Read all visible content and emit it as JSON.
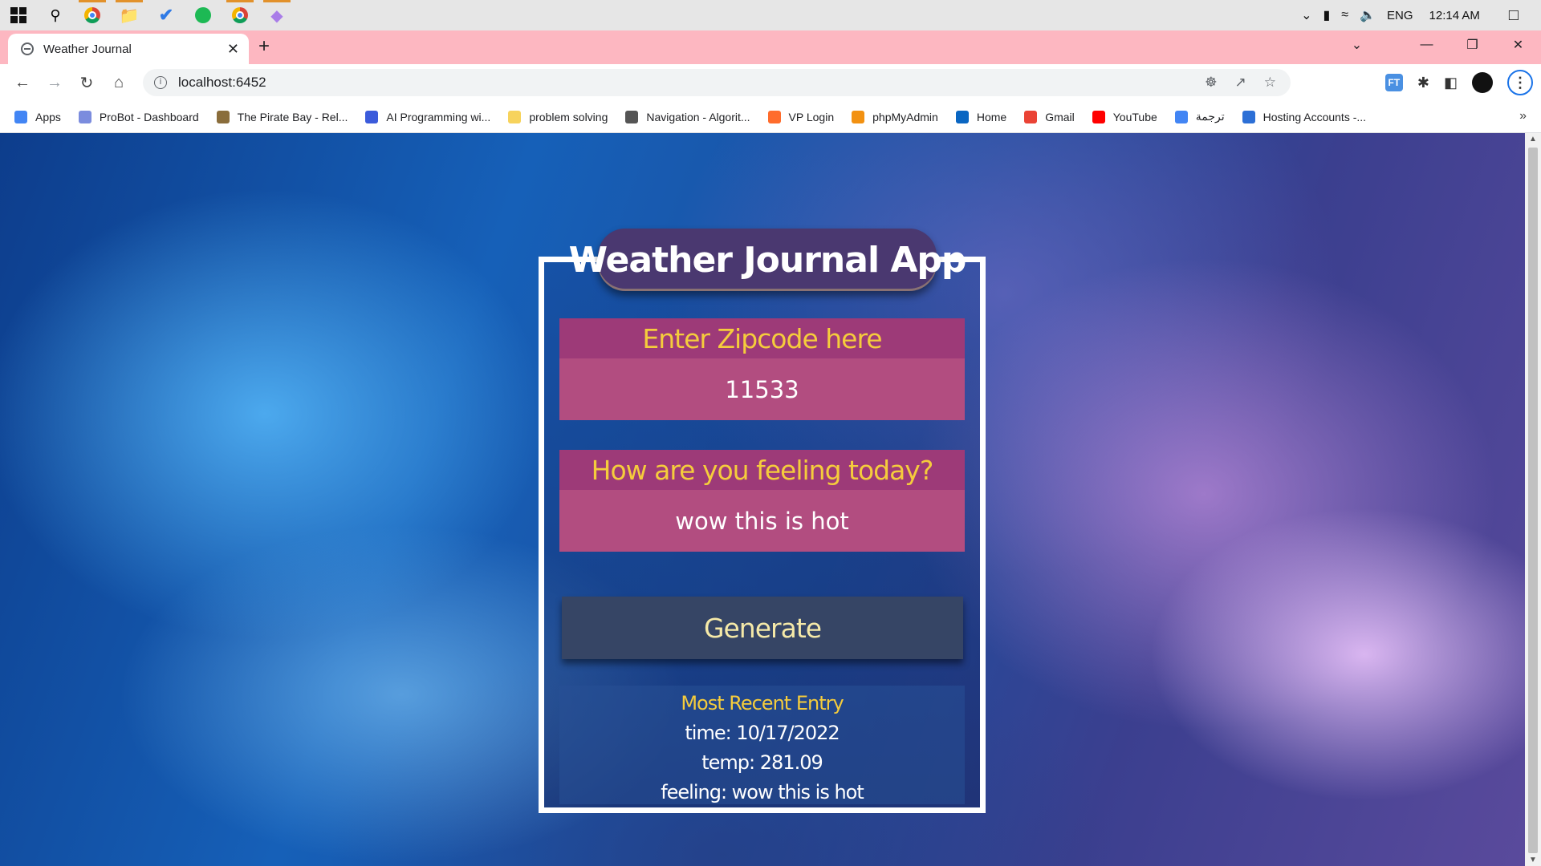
{
  "taskbar": {
    "language": "ENG",
    "clock": "12:14 AM"
  },
  "browser": {
    "tab_title": "Weather Journal",
    "url": "localhost:6452",
    "extension_label": "FT"
  },
  "bookmarks": [
    {
      "label": "Apps",
      "icon": "apps-grid-icon",
      "color": "#4285f4"
    },
    {
      "label": "ProBot - Dashboard",
      "icon": "probot-icon",
      "color": "#7b8cde"
    },
    {
      "label": "The Pirate Bay - Rel...",
      "icon": "pirate-ship-icon",
      "color": "#8a6d3b"
    },
    {
      "label": "AI Programming wi...",
      "icon": "udacity-icon",
      "color": "#3b5bdb"
    },
    {
      "label": "problem solving",
      "icon": "folder-icon",
      "color": "#f7d35c"
    },
    {
      "label": "Navigation - Algorit...",
      "icon": "owl-icon",
      "color": "#555555"
    },
    {
      "label": "VP Login",
      "icon": "cpanel-icon",
      "color": "#ff6c2c"
    },
    {
      "label": "phpMyAdmin",
      "icon": "phpmyadmin-icon",
      "color": "#f29111"
    },
    {
      "label": "Home",
      "icon": "linkedin-icon",
      "color": "#0a66c2"
    },
    {
      "label": "Gmail",
      "icon": "gmail-icon",
      "color": "#ea4335"
    },
    {
      "label": "YouTube",
      "icon": "youtube-icon",
      "color": "#ff0000"
    },
    {
      "label": "ترجمة",
      "icon": "translate-icon",
      "color": "#4285f4"
    },
    {
      "label": "Hosting Accounts -...",
      "icon": "infinity-icon",
      "color": "#2c6fd6"
    }
  ],
  "app": {
    "title": "Weather Journal App",
    "zip_label": "Enter Zipcode here",
    "zip_value": "11533",
    "feelings_label": "How are you feeling today?",
    "feelings_value": "wow this is hot",
    "generate_label": "Generate",
    "entry_title": "Most Recent Entry",
    "entry_time": "time: 10/17/2022",
    "entry_temp": "temp: 281.09",
    "entry_feeling": "feeling: wow this is hot"
  },
  "colors": {
    "tab_strip": "#fdb7c1",
    "label_bg": "#9d3a78",
    "label_text": "#f5cc3c",
    "input_bg": "#b24d80",
    "button_bg": "#364565",
    "title_bg": "#4a3870"
  }
}
